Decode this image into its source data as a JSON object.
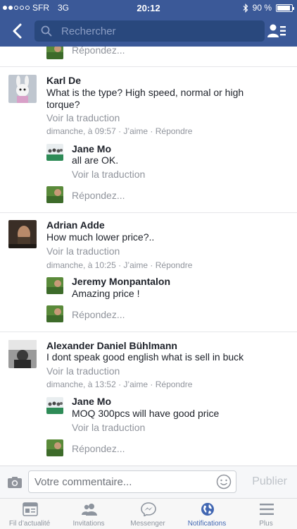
{
  "status_bar": {
    "carrier": "SFR",
    "network": "3G",
    "time": "20:12",
    "battery": "90 %",
    "battery_level": 0.9
  },
  "header": {
    "search_placeholder": "Rechercher",
    "back_icon": "chevron-left-icon",
    "friends_icon": "friend-list-icon"
  },
  "top_reply": {
    "label": "Répondez..."
  },
  "threads": [
    {
      "author": "Karl De",
      "text_line1": "What is the type? High speed, normal or high",
      "text_line2": "torque?",
      "translate": "Voir la traduction",
      "meta": "dimanche, à 09:57 · J’aime · Répondre",
      "reply": {
        "author": "Jane Mo",
        "text": "all are OK.",
        "translate": "Voir la traduction"
      },
      "reply_prompt": "Répondez..."
    },
    {
      "author": "Adrian Adde",
      "text_line1": "How much lower price?..",
      "translate": "Voir la traduction",
      "meta": "dimanche, à 10:25 · J’aime · Répondre",
      "reply": {
        "author": "Jeremy Monpantalon",
        "text": "Amazing price !"
      },
      "reply_prompt": "Répondez..."
    },
    {
      "author": "Alexander Daniel Bühlmann",
      "text_line1": "I dont speak good english what is sell in buck",
      "translate": "Voir la traduction",
      "meta": "dimanche, à 13:52 · J’aime · Répondre",
      "reply": {
        "author": "Jane Mo",
        "text": "MOQ 300pcs will have good price",
        "translate": "Voir la traduction"
      },
      "reply_prompt": "Répondez..."
    }
  ],
  "composer": {
    "placeholder": "Votre commentaire...",
    "publish": "Publier"
  },
  "tabs": [
    {
      "label": "Fil d’actualité",
      "icon": "news-feed-icon",
      "active": false
    },
    {
      "label": "Invitations",
      "icon": "friend-requests-icon",
      "active": false
    },
    {
      "label": "Messenger",
      "icon": "messenger-icon",
      "active": false
    },
    {
      "label": "Notifications",
      "icon": "globe-notifications-icon",
      "active": true
    },
    {
      "label": "Plus",
      "icon": "menu-icon",
      "active": false
    }
  ],
  "colors": {
    "brand": "#3b5998",
    "active_tab": "#4267b2",
    "meta_text": "#90949c"
  }
}
